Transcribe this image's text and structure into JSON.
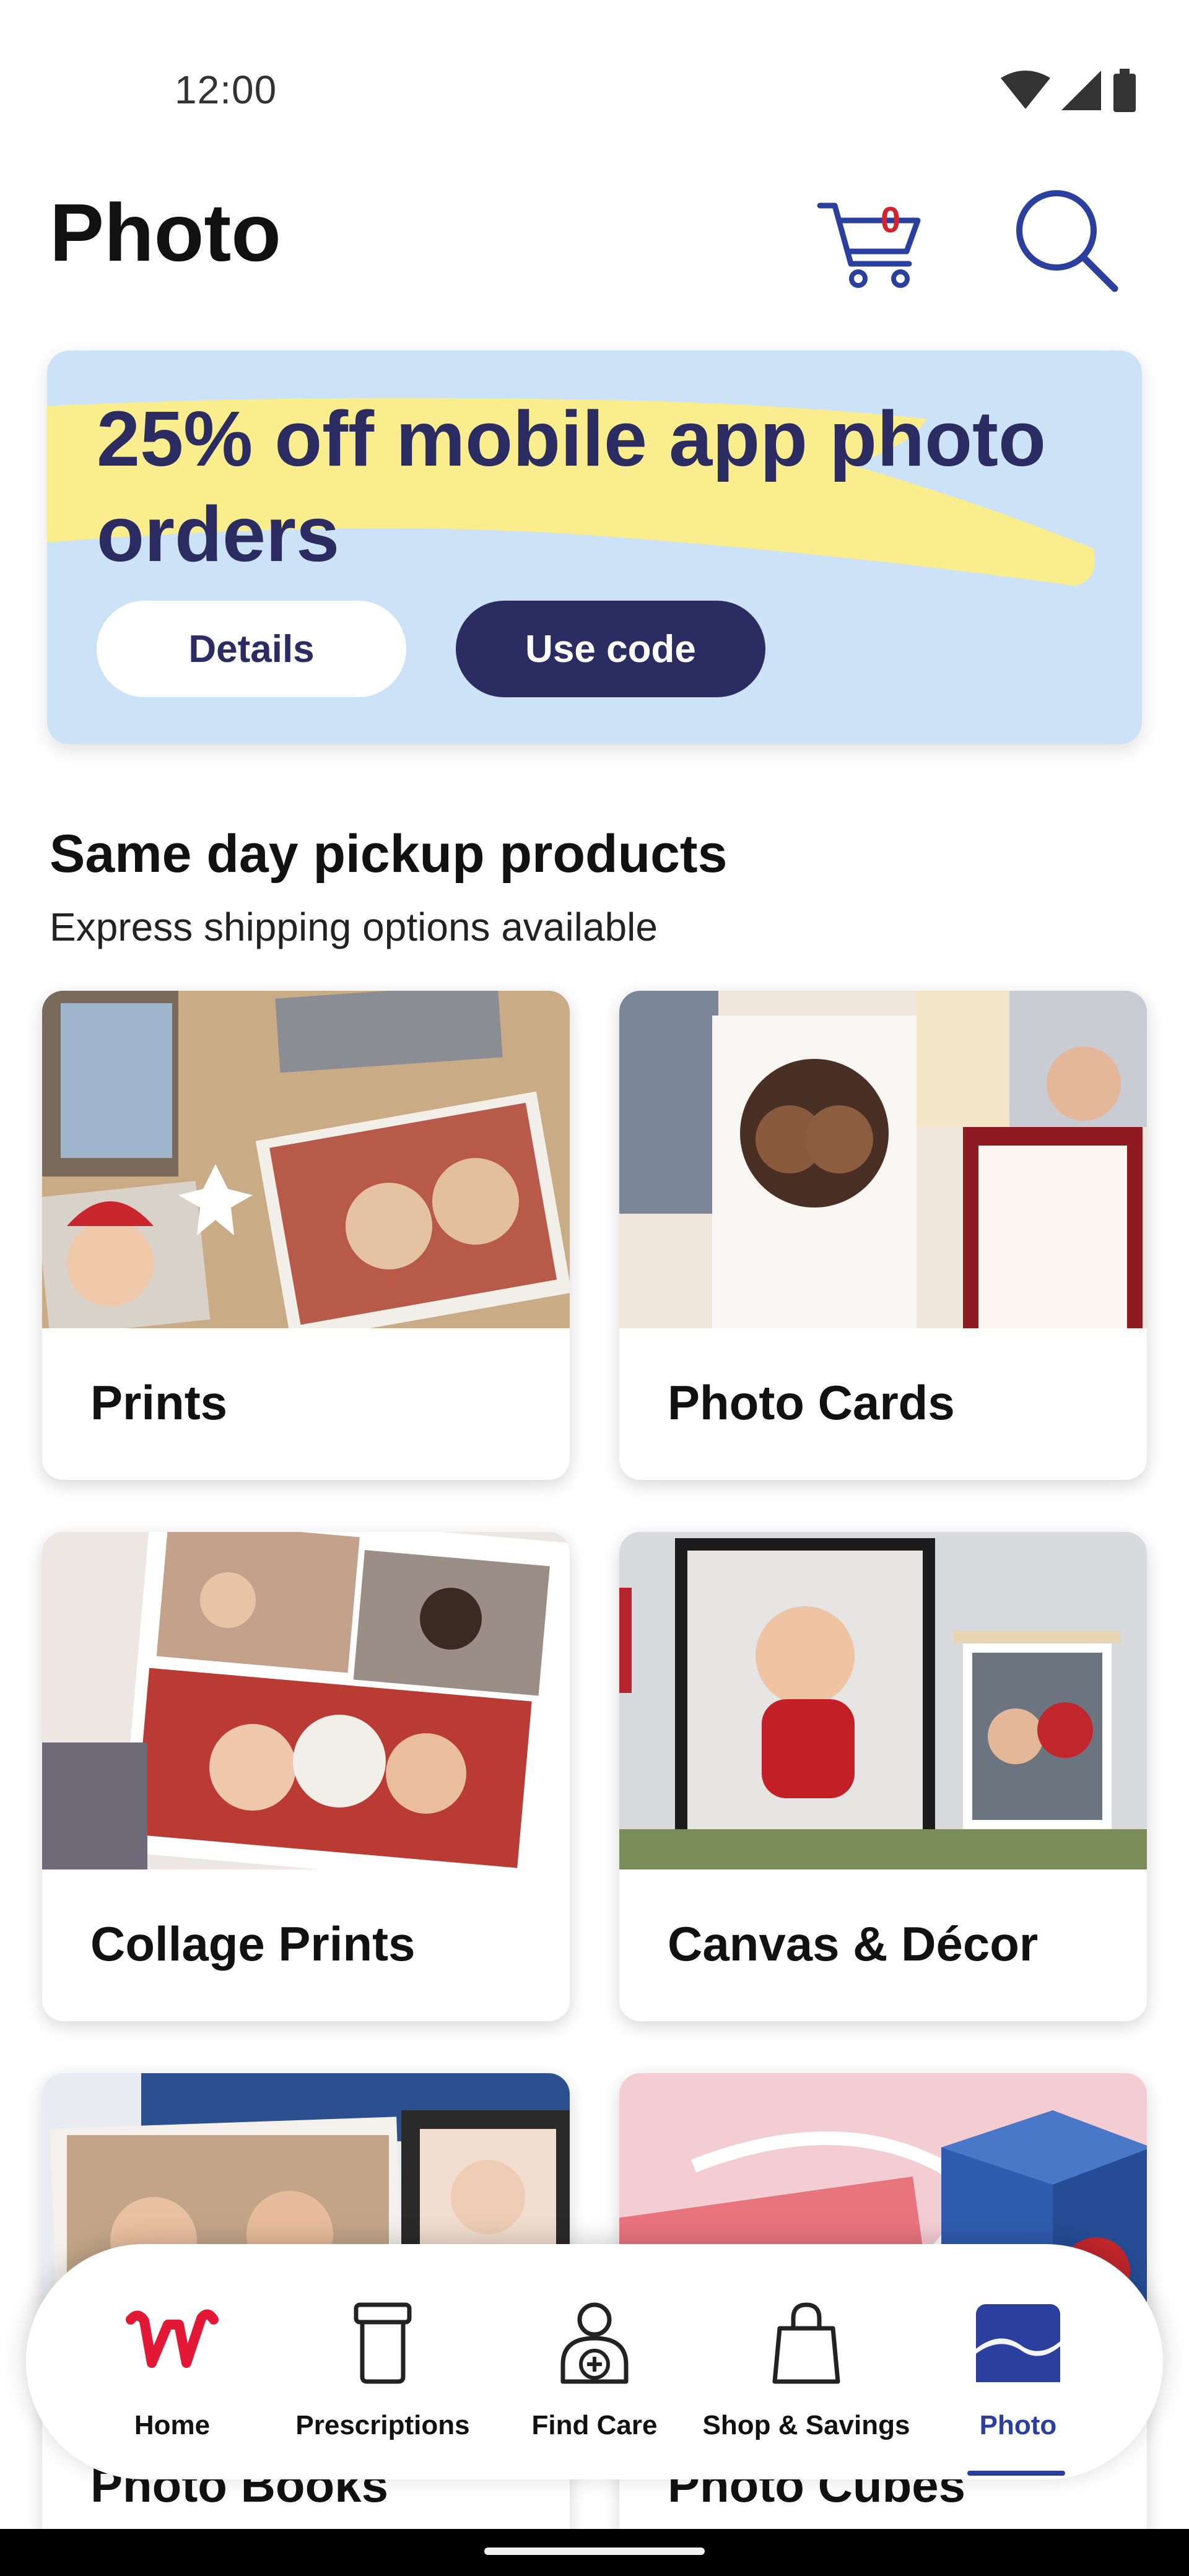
{
  "status_bar": {
    "time": "12:00",
    "icons": [
      "wifi-icon",
      "cellular-signal-icon",
      "battery-icon"
    ]
  },
  "header": {
    "title": "Photo",
    "cart_count": "0",
    "icons": [
      "cart-icon",
      "search-icon"
    ]
  },
  "promo": {
    "headline": "25% off mobile app photo orders",
    "details_label": "Details",
    "use_code_label": "Use code",
    "colors": {
      "background": "#cce3f7",
      "highlight": "#faed8d",
      "navy": "#2b2c61"
    }
  },
  "section": {
    "title": "Same day pickup products",
    "subtitle": "Express shipping options available"
  },
  "products": [
    {
      "label": "Prints"
    },
    {
      "label": "Photo Cards"
    },
    {
      "label": "Collage Prints"
    },
    {
      "label": "Canvas & Décor"
    },
    {
      "label": "Photo Books"
    },
    {
      "label": "Photo Cubes"
    }
  ],
  "bottom_nav": {
    "items": [
      {
        "label": "Home",
        "icon": "walgreens-w-icon"
      },
      {
        "label": "Prescriptions",
        "icon": "pill-bottle-icon"
      },
      {
        "label": "Find Care",
        "icon": "person-plus-icon"
      },
      {
        "label": "Shop & Savings",
        "icon": "shopping-bag-icon"
      },
      {
        "label": "Photo",
        "icon": "photo-icon"
      }
    ],
    "active": "Photo",
    "active_color": "#2b3f9e"
  }
}
